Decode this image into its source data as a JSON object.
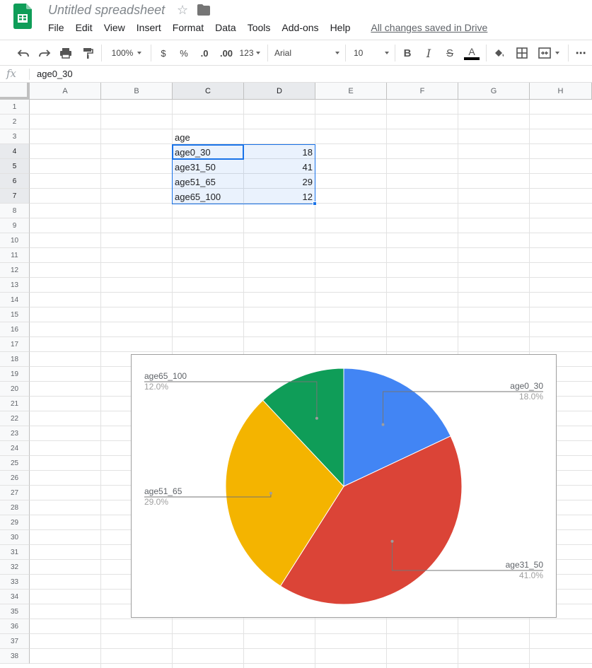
{
  "app": {
    "title": "Untitled spreadsheet",
    "save_status": "All changes saved in Drive",
    "menu": [
      "File",
      "Edit",
      "View",
      "Insert",
      "Format",
      "Data",
      "Tools",
      "Add-ons",
      "Help"
    ]
  },
  "toolbar": {
    "zoom": "100%",
    "currency": "$",
    "percent": "%",
    "decrease_decimal": ".0",
    "increase_decimal": ".00",
    "more_formats": "123",
    "font": "Arial",
    "font_size": "10",
    "bold": "B",
    "italic": "I",
    "strikethrough": "S",
    "text_color_letter": "A",
    "more": "⋯"
  },
  "formula_bar": {
    "fx": "fx",
    "value": "age0_30"
  },
  "grid": {
    "columns": [
      "A",
      "B",
      "C",
      "D",
      "E",
      "F",
      "G",
      "H"
    ],
    "rows": [
      1,
      2,
      3,
      4,
      5,
      6,
      7,
      8,
      9,
      10,
      11,
      12,
      13,
      14,
      15,
      16,
      17,
      18,
      19,
      20,
      21,
      22,
      23,
      24,
      25,
      26,
      27,
      28,
      29,
      30,
      31,
      32,
      33,
      34,
      35,
      36,
      37,
      38
    ],
    "header_cell": {
      "ref": "C3",
      "text": "age"
    },
    "data_rows": [
      {
        "label": "age0_30",
        "value": "18"
      },
      {
        "label": "age31_50",
        "value": "41"
      },
      {
        "label": "age51_65",
        "value": "29"
      },
      {
        "label": "age65_100",
        "value": "12"
      }
    ],
    "active_cell": "C4",
    "selected_range": "C4:D7"
  },
  "chart_data": {
    "type": "pie",
    "categories": [
      "age0_30",
      "age31_50",
      "age51_65",
      "age65_100"
    ],
    "values": [
      18,
      41,
      29,
      12
    ],
    "percent_labels": [
      "18.0%",
      "41.0%",
      "29.0%",
      "12.0%"
    ],
    "colors": [
      "#4285f4",
      "#db4437",
      "#f4b400",
      "#0f9d58"
    ],
    "title": "",
    "legend": "labeled"
  },
  "colors": {
    "accent": "#1a73e8",
    "sheets_green": "#0f9d58",
    "text_color_bar": "#000000"
  }
}
